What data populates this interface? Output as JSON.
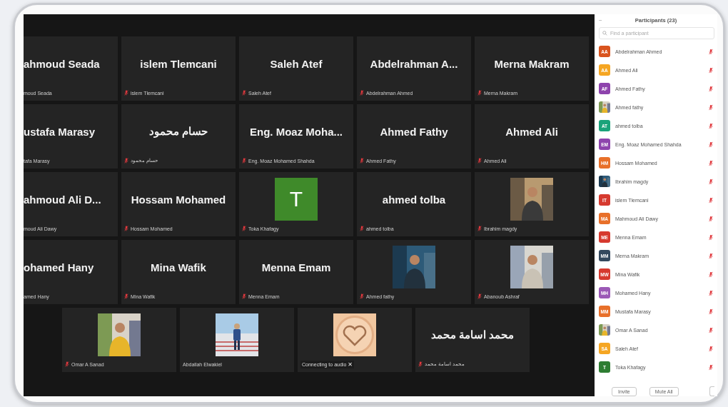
{
  "grid_rows": [
    {
      "tiles": [
        {
          "kind": "name",
          "name": "ahmoud Seada",
          "label": "moud Seada"
        },
        {
          "kind": "name",
          "name": "islem Tlemcani",
          "label": "islem Tlemcani",
          "muted": true
        },
        {
          "kind": "name",
          "name": "Saleh Atef",
          "label": "Saleh Atef",
          "muted": true
        },
        {
          "kind": "name",
          "name": "Abdelrahman  A...",
          "label": "Abdelrahman Ahmed",
          "muted": true
        },
        {
          "kind": "name",
          "name": "Merna Makram",
          "label": "Merna Makram",
          "muted": true
        }
      ]
    },
    {
      "tiles": [
        {
          "kind": "name",
          "name": "ustafa Marasy",
          "label": "tafa Marasy"
        },
        {
          "kind": "name",
          "name": "حسام محمود",
          "label": "حسام محمود",
          "muted": true
        },
        {
          "kind": "name",
          "name": "Eng. Moaz Moha...",
          "label": "Eng. Moaz Mohamed Shahda",
          "muted": true
        },
        {
          "kind": "name",
          "name": "Ahmed Fathy",
          "label": "Ahmed Fathy",
          "muted": true
        },
        {
          "kind": "name",
          "name": "Ahmed Ali",
          "label": "Ahmed Ali",
          "muted": true
        }
      ]
    },
    {
      "tiles": [
        {
          "kind": "name",
          "name": "ahmoud Ali D...",
          "label": "moud Ali Dawy"
        },
        {
          "kind": "name",
          "name": "Hossam Mohamed",
          "label": "Hossam Mohamed",
          "muted": true
        },
        {
          "kind": "avatar",
          "initial": "T",
          "color": "#3f8a2a",
          "label": "Toka Khafagy",
          "muted": true
        },
        {
          "kind": "name",
          "name": "ahmed tolba",
          "label": "ahmed tolba",
          "muted": true
        },
        {
          "kind": "picture",
          "label": "Ibrahim magdy",
          "muted": true
        }
      ]
    },
    {
      "tiles": [
        {
          "kind": "name",
          "name": "ohamed Hany",
          "label": "amed Hany"
        },
        {
          "kind": "name",
          "name": "Mina Wafik",
          "label": "Mina Wafik",
          "muted": true
        },
        {
          "kind": "name",
          "name": "Menna Emam",
          "label": "Menna Emam",
          "muted": true
        },
        {
          "kind": "picture",
          "label": "Ahmed fathy",
          "muted": true
        },
        {
          "kind": "picture",
          "label": "Abanoub Ashraf",
          "muted": true
        }
      ]
    },
    {
      "tiles": [
        {
          "kind": "picture",
          "label": "Omar A Sanad",
          "muted": true
        },
        {
          "kind": "picture",
          "label": "Abdallah Elwakiel",
          "muted": false
        },
        {
          "kind": "picture",
          "label": "Connecting to audio",
          "dismiss": "✕"
        },
        {
          "kind": "name",
          "name": "محمد اسامة محمد",
          "label": "محمد اسامة محمد",
          "muted": true
        }
      ]
    }
  ],
  "participants": {
    "minimize": "−",
    "title": "Participants (23)",
    "search": {
      "placeholder": "Find a participant"
    },
    "items": [
      {
        "kind": "initials",
        "initials": "AA",
        "color": "#d9541e",
        "name": "Abdelrahman Ahmed",
        "muted": true
      },
      {
        "kind": "initials",
        "initials": "AA",
        "color": "#f5a623",
        "name": "Ahmed Ali",
        "muted": true
      },
      {
        "kind": "initials",
        "initials": "AF",
        "color": "#8e44ad",
        "name": "Ahmed Fathy",
        "muted": true
      },
      {
        "kind": "picture",
        "name": "Ahmed fathy",
        "muted": true
      },
      {
        "kind": "initials",
        "initials": "AT",
        "color": "#1aa37a",
        "name": "ahmed tolba",
        "muted": true
      },
      {
        "kind": "initials",
        "initials": "EM",
        "color": "#8e44ad",
        "name": "Eng. Moaz Mohamed Shahda",
        "muted": true
      },
      {
        "kind": "initials",
        "initials": "HM",
        "color": "#e8702a",
        "name": "Hossam Mohamed",
        "muted": true
      },
      {
        "kind": "picture",
        "name": "Ibrahim magdy",
        "muted": true
      },
      {
        "kind": "initials",
        "initials": "IT",
        "color": "#d63a2f",
        "name": "islem Tlemcani",
        "muted": true
      },
      {
        "kind": "initials",
        "initials": "MA",
        "color": "#e8702a",
        "name": "Mahmoud Ali Dawy",
        "muted": true
      },
      {
        "kind": "initials",
        "initials": "ME",
        "color": "#d63a2f",
        "name": "Menna Emam",
        "muted": true
      },
      {
        "kind": "initials",
        "initials": "MM",
        "color": "#34495e",
        "name": "Merna Makram",
        "muted": true
      },
      {
        "kind": "initials",
        "initials": "MW",
        "color": "#d63a2f",
        "name": "Mina Wafik",
        "muted": true
      },
      {
        "kind": "initials",
        "initials": "MH",
        "color": "#9b59b6",
        "name": "Mohamed Hany",
        "muted": true
      },
      {
        "kind": "initials",
        "initials": "MM",
        "color": "#e8702a",
        "name": "Mustafa Marasy",
        "muted": true
      },
      {
        "kind": "picture",
        "name": "Omar A Sanad",
        "muted": true
      },
      {
        "kind": "initials",
        "initials": "SA",
        "color": "#f5a623",
        "name": "Saleh Atef",
        "muted": true
      },
      {
        "kind": "initials",
        "initials": "T",
        "color": "#2e7d32",
        "name": "Toka Khafagy",
        "muted": true
      }
    ],
    "buttons": [
      "Invite",
      "Mute All"
    ]
  }
}
